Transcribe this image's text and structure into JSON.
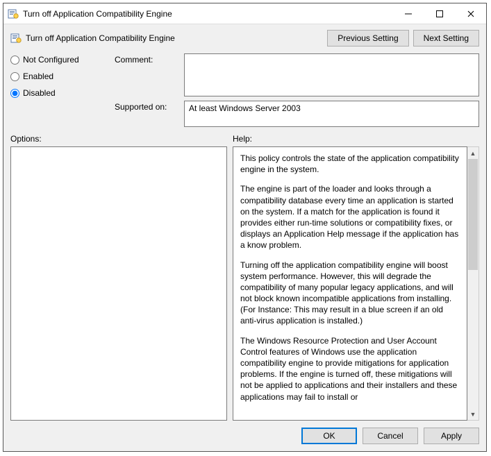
{
  "window": {
    "title": "Turn off Application Compatibility Engine"
  },
  "header": {
    "title": "Turn off Application Compatibility Engine",
    "prev": "Previous Setting",
    "next": "Next Setting"
  },
  "radios": {
    "not_configured": "Not Configured",
    "enabled": "Enabled",
    "disabled": "Disabled",
    "selected": "disabled"
  },
  "labels": {
    "comment": "Comment:",
    "supported_on": "Supported on:",
    "options": "Options:",
    "help": "Help:"
  },
  "comment": "",
  "supported_on": "At least Windows Server 2003",
  "help": {
    "p1": "This policy controls the state of the application compatibility engine in the system.",
    "p2": "The engine is part of the loader and looks through a compatibility database every time an application is started on the system.  If a match for the application is found it provides either run-time solutions or compatibility fixes, or displays an Application Help message if the application has a know problem.",
    "p3": "Turning off the application compatibility engine will boost system performance.  However, this will degrade the compatibility of many popular legacy applications, and will not block known incompatible applications from installing.  (For Instance: This may result in a blue screen if an old anti-virus application is installed.)",
    "p4": "The Windows Resource Protection and User Account Control features of Windows use the application compatibility engine to provide mitigations for application problems. If the engine is turned off, these mitigations will not be applied to applications and their installers and these applications may fail to install or"
  },
  "buttons": {
    "ok": "OK",
    "cancel": "Cancel",
    "apply": "Apply"
  }
}
